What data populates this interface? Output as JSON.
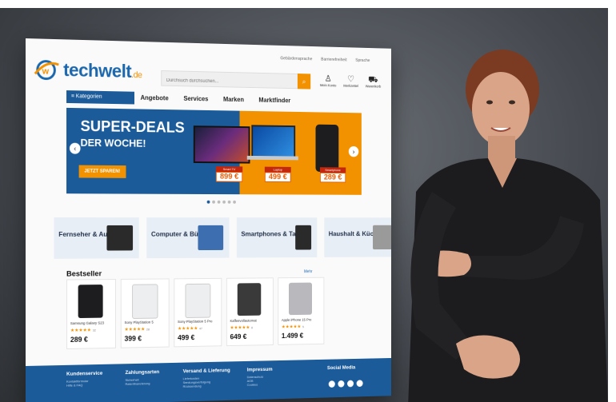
{
  "toplinks": [
    "Gebärdensprache",
    "Barrierefreiheit",
    "Sprache"
  ],
  "logo": {
    "name": "techwelt",
    "tld": ".de"
  },
  "search": {
    "placeholder": "Durchsuch durchsuchen..."
  },
  "header_icons": [
    {
      "icon": "user-icon",
      "label": "Mein Konto"
    },
    {
      "icon": "heart-icon",
      "label": "Merkzettel"
    },
    {
      "icon": "cart-icon",
      "label": "Warenkorb"
    }
  ],
  "nav": {
    "categories_label": "≡ Kategorien",
    "items": [
      "Angebote",
      "Services",
      "Marken",
      "Marktfinder"
    ]
  },
  "banner": {
    "title": "SUPER-DEALS",
    "subtitle": "DER WOCHE!",
    "cta": "JETZT SPAREN!",
    "deals": [
      {
        "label": "Smart TV",
        "price": "899 €"
      },
      {
        "label": "Laptop",
        "price": "499 €"
      },
      {
        "label": "Smartphone",
        "price": "289 €"
      }
    ]
  },
  "categories": [
    {
      "label": "Fernseher & Audio"
    },
    {
      "label": "Computer & Büro"
    },
    {
      "label": "Smartphones & Tarife"
    },
    {
      "label": "Haushalt & Küche"
    }
  ],
  "bestseller": {
    "title": "Bestseller",
    "more": "Mehr",
    "products": [
      {
        "name": "Samsung Galaxy S23",
        "stars": "★★★★★",
        "count": "32",
        "price": "289 €",
        "color": "#1d1d1f"
      },
      {
        "name": "Sony PlayStation 5",
        "stars": "★★★★★",
        "count": "28",
        "price": "399 €",
        "color": "#e9ecef"
      },
      {
        "name": "Sony PlayStation 5 Pro",
        "stars": "★★★★★",
        "count": "47",
        "price": "499 €",
        "color": "#e9ecef"
      },
      {
        "name": "Kaffeevollautomat",
        "stars": "★★★★★",
        "count": "8",
        "price": "649 €",
        "color": "#3a3a3a"
      },
      {
        "name": "Apple iPhone 15 Pro",
        "stars": "★★★★★",
        "count": "5",
        "price": "1.499 €",
        "color": "#b9b9bd"
      }
    ]
  },
  "footer": {
    "columns": [
      {
        "title": "Kundenservice",
        "lines": [
          "Kontaktformular",
          "Hilfe & FAQ"
        ]
      },
      {
        "title": "Zahlungsarten",
        "lines": [
          "Sicherheit",
          "Ratenfinanzierung"
        ]
      },
      {
        "title": "Versand & Lieferung",
        "lines": [
          "Lieferkosten",
          "Sendungsverfolgung",
          "Rücksendung"
        ]
      },
      {
        "title": "Impressum",
        "lines": [
          "Datenschutz",
          "AGB",
          "Cookies"
        ]
      },
      {
        "title": "Social Media",
        "lines": []
      }
    ]
  },
  "colors": {
    "brand_blue": "#1b5b9a",
    "accent_orange": "#f39200",
    "deal_red": "#c3270e"
  }
}
